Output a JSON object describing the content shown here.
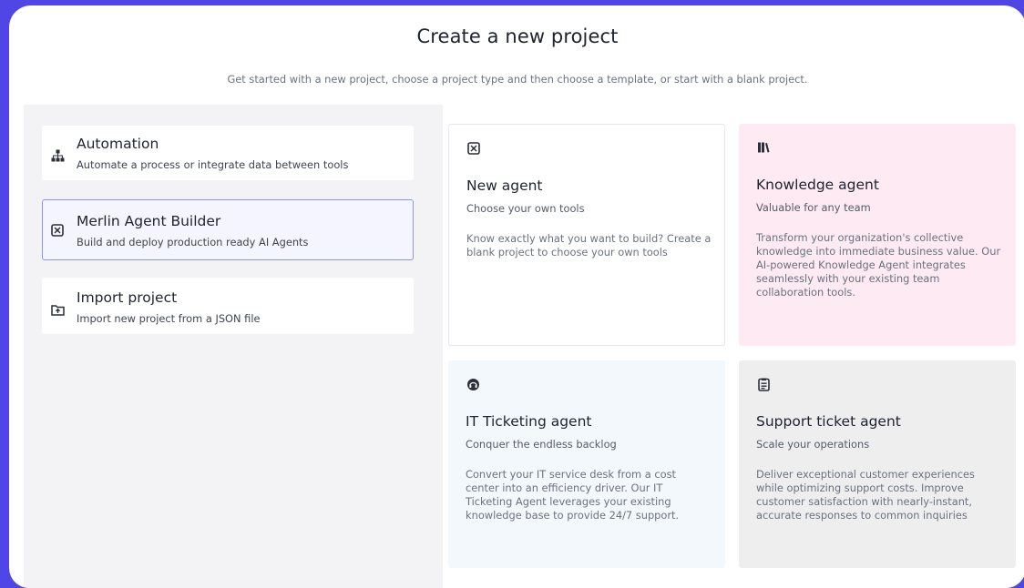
{
  "modal": {
    "title": "Create a new project",
    "subtitle": "Get started with a new project, choose a project type and then choose a template, or start with a blank project."
  },
  "project_types": [
    {
      "name": "Automation",
      "description": "Automate a process or integrate data between tools",
      "icon": "sitemap-icon",
      "selected": false
    },
    {
      "name": "Merlin Agent Builder",
      "description": "Build and deploy production ready AI Agents",
      "icon": "agent-grid-icon",
      "selected": true
    },
    {
      "name": "Import project",
      "description": "Import new project from a JSON file",
      "icon": "folder-import-icon",
      "selected": false
    }
  ],
  "templates": [
    {
      "name": "New agent",
      "subtitle": "Choose your own tools",
      "description": "Know exactly what you want to build? Create a blank project to choose your own tools",
      "icon": "agent-grid-icon",
      "background": "#ffffff"
    },
    {
      "name": "Knowledge agent",
      "subtitle": "Valuable for any team",
      "description": "Transform your organization's collective knowledge into immediate business value. Our AI-powered Knowledge Agent integrates seamlessly with your existing team collaboration tools.",
      "icon": "books-icon",
      "background": "#fdeaf2"
    },
    {
      "name": "IT Ticketing agent",
      "subtitle": "Conquer the endless backlog",
      "description": "Convert your IT service desk from a cost center into an efficiency driver. Our IT Ticketing Agent leverages your existing knowledge base to provide 24/7 support.",
      "icon": "headset-icon",
      "background": "#f2f8fb"
    },
    {
      "name": "Support ticket agent",
      "subtitle": "Scale your operations",
      "description": "Deliver exceptional customer experiences while optimizing support costs. Improve customer satisfaction with nearly-instant, accurate responses to common inquiries",
      "icon": "clipboard-icon",
      "background": "#eeeeee"
    }
  ],
  "colors": {
    "background": "#4f46e5",
    "selected_border": "#8b93f5",
    "selected_fill": "#f4f5fe",
    "left_pane": "#f3f3f6"
  }
}
